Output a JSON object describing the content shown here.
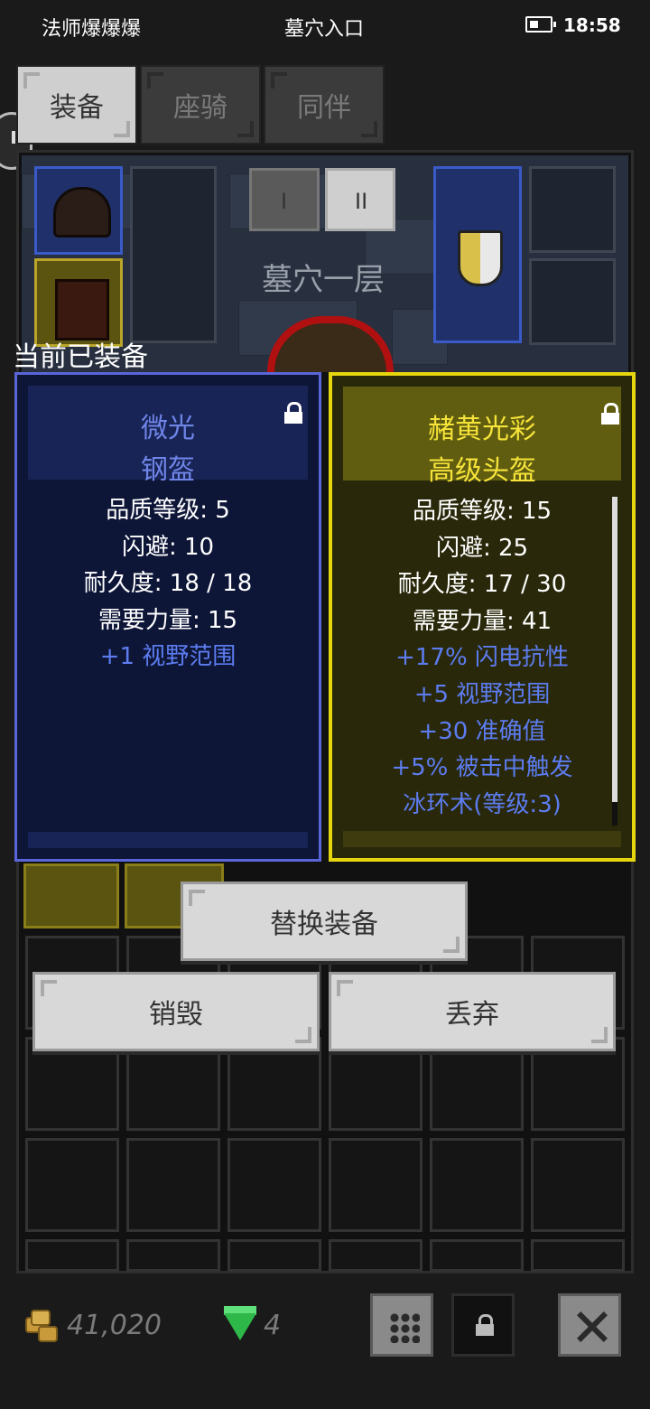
{
  "status_bar": {
    "left_text": "法师爆爆爆",
    "center_text": "墓穴入口",
    "time": "18:58"
  },
  "tabs": [
    {
      "label": "装备",
      "active": true
    },
    {
      "label": "座骑",
      "active": false
    },
    {
      "label": "同伴",
      "active": false
    }
  ],
  "scene": {
    "level_name": "墓穴一层",
    "page_buttons": [
      "I",
      "II"
    ]
  },
  "equipped_label": "当前已装备",
  "card_equipped": {
    "title_line1": "微光",
    "title_line2": "钢盔",
    "color": "#5a66d8",
    "stats": [
      "品质等级: 5",
      "闪避: 10",
      "耐久度: 18 / 18",
      "需要力量: 15"
    ],
    "bonuses": [
      "+1 视野范围"
    ]
  },
  "card_new": {
    "title_line1": "赭黄光彩",
    "title_line2": "高级头盔",
    "color": "#e6d60e",
    "stats": [
      "品质等级: 15",
      "闪避: 25",
      "耐久度: 17 / 30",
      "需要力量: 41"
    ],
    "bonuses": [
      "+17% 闪电抗性",
      "+5 视野范围",
      "+30 准确值",
      "+5% 被击中触发",
      "冰环术(等级:3)"
    ]
  },
  "actions": {
    "replace": "替换装备",
    "destroy": "销毁",
    "discard": "丢弃"
  },
  "currency": {
    "gold": "41,020",
    "gems": "4",
    "gold_icon": "coins-icon",
    "gem_icon": "emerald-icon"
  }
}
